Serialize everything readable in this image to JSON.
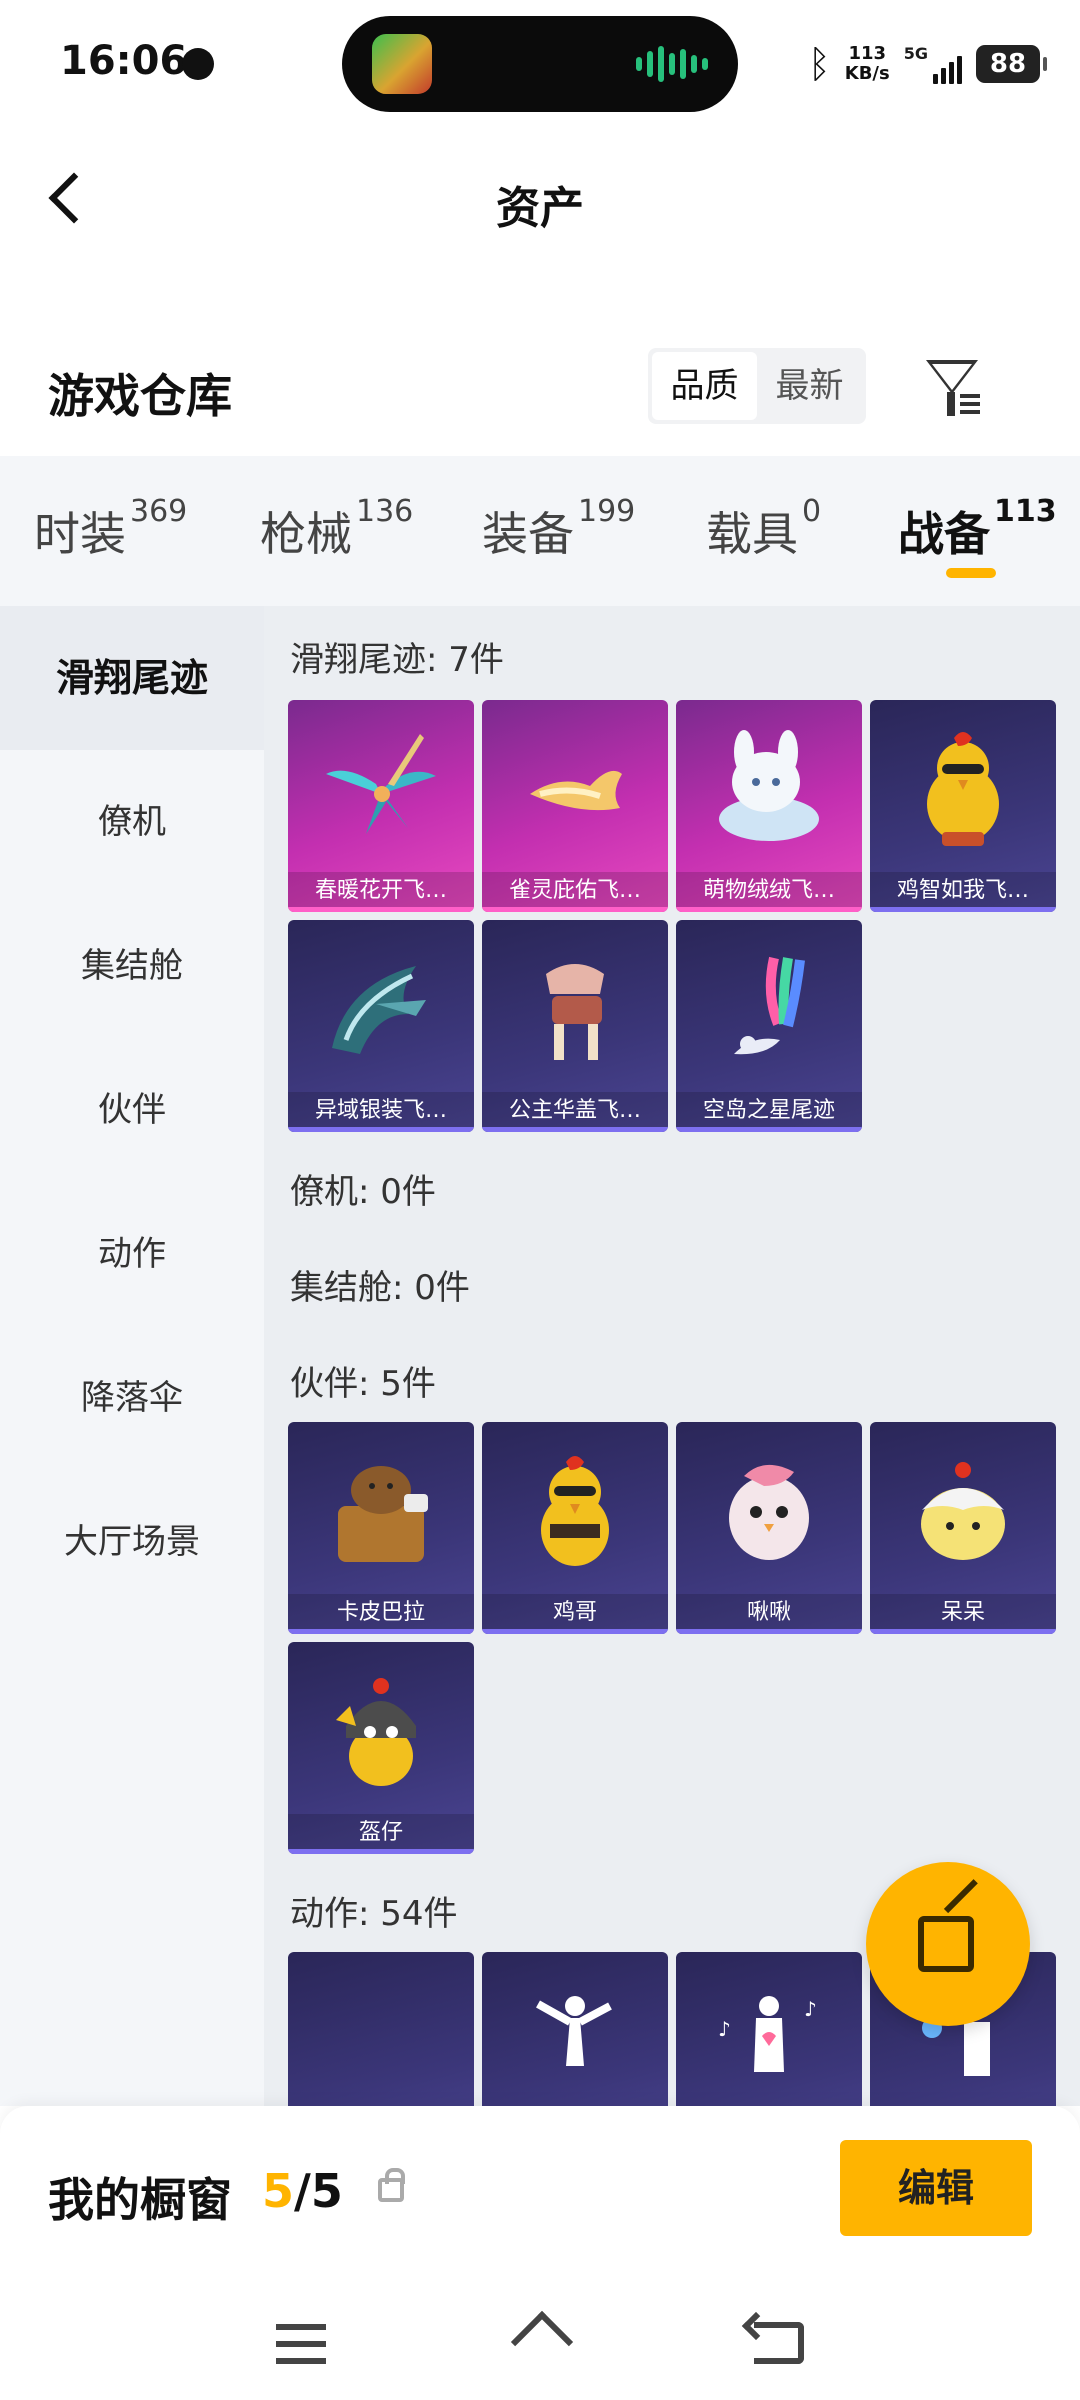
{
  "status_bar": {
    "time": "16:06",
    "network_speed_value": "113",
    "network_speed_unit": "KB/s",
    "network_type": "5G",
    "battery": "88",
    "icons": [
      "globe-icon",
      "app-icon",
      "audio-wave-icon",
      "bluetooth-icon",
      "signal-icon",
      "battery-icon"
    ]
  },
  "header": {
    "title": "资产",
    "back_icon": "chevron-left-icon"
  },
  "warehouse": {
    "title": "游戏仓库",
    "sort_options": [
      "品质",
      "最新"
    ],
    "selected_sort": "品质",
    "filter_icon": "filter-icon"
  },
  "category_tabs": [
    {
      "label": "时装",
      "count": "369",
      "active": false
    },
    {
      "label": "枪械",
      "count": "136",
      "active": false
    },
    {
      "label": "装备",
      "count": "199",
      "active": false
    },
    {
      "label": "载具",
      "count": "0",
      "active": false
    },
    {
      "label": "战备",
      "count": "113",
      "active": true
    }
  ],
  "sidebar": {
    "items": [
      "滑翔尾迹",
      "僚机",
      "集结舱",
      "伙伴",
      "动作",
      "降落伞",
      "大厅场景"
    ],
    "active": "滑翔尾迹"
  },
  "sections": [
    {
      "title": "滑翔尾迹: 7件",
      "items": [
        {
          "name": "春暖花开飞…",
          "rarity": "pink"
        },
        {
          "name": "雀灵庇佑飞…",
          "rarity": "pink"
        },
        {
          "name": "萌物绒绒飞…",
          "rarity": "pink"
        },
        {
          "name": "鸡智如我飞…",
          "rarity": "purple"
        },
        {
          "name": "异域银装飞…",
          "rarity": "purple"
        },
        {
          "name": "公主华盖飞…",
          "rarity": "purple"
        },
        {
          "name": "空岛之星尾迹",
          "rarity": "purple"
        }
      ]
    },
    {
      "title": "僚机: 0件",
      "items": []
    },
    {
      "title": "集结舱: 0件",
      "items": []
    },
    {
      "title": "伙伴: 5件",
      "items": [
        {
          "name": "卡皮巴拉",
          "rarity": "purple"
        },
        {
          "name": "鸡哥",
          "rarity": "purple"
        },
        {
          "name": "啾啾",
          "rarity": "purple"
        },
        {
          "name": "呆呆",
          "rarity": "purple"
        },
        {
          "name": "盔仔",
          "rarity": "purple"
        }
      ]
    },
    {
      "title": "动作: 54件",
      "items": [
        {
          "name": "",
          "rarity": "purple"
        },
        {
          "name": "",
          "rarity": "purple"
        },
        {
          "name": "",
          "rarity": "purple"
        },
        {
          "name": "",
          "rarity": "purple"
        }
      ]
    }
  ],
  "share_button_icon": "share-external-icon",
  "showcase": {
    "label": "我的橱窗",
    "current": "5",
    "separator": "/",
    "total": "5",
    "lock_icon": "lock-icon",
    "edit_label": "编辑"
  },
  "nav_bar": {
    "icons": [
      "menu-icon",
      "home-icon",
      "back-icon"
    ]
  },
  "colors": {
    "accent": "#ffb400",
    "rarity_pink": "#c32fb0",
    "rarity_purple": "#3b3679"
  }
}
